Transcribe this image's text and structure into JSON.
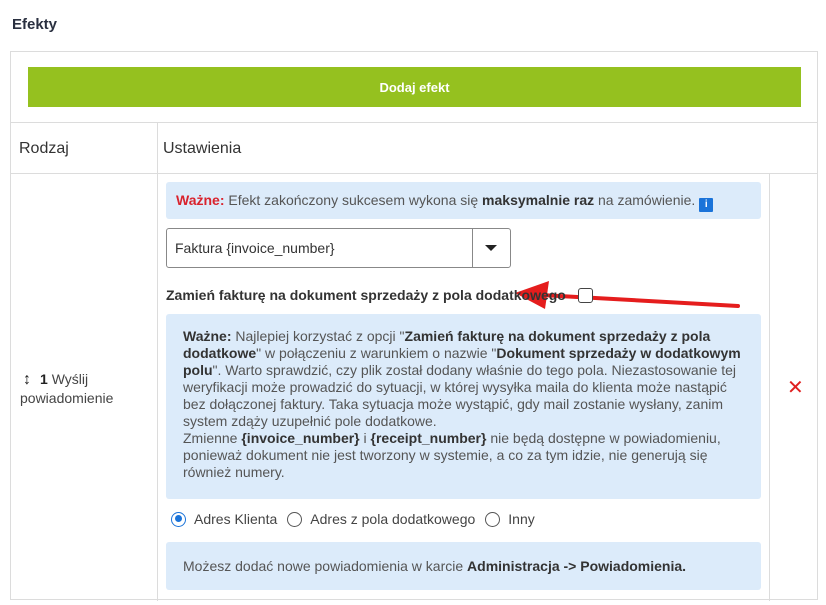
{
  "section": {
    "title": "Efekty"
  },
  "toolbar": {
    "add_label": "Dodaj efekt"
  },
  "table": {
    "headers": [
      "Rodzaj",
      "Ustawienia"
    ],
    "row": {
      "number": "1",
      "type_label": "Wyślij powiadomienie"
    }
  },
  "notice1": {
    "prefix": "Ważne:",
    "text_a": " Efekt zakończony sukcesem wykona się ",
    "bold": "maksymalnie raz",
    "text_b": " na zamówienie."
  },
  "info_icon_text": "i",
  "select": {
    "value": "Faktura {invoice_number}"
  },
  "checkbox": {
    "label": "Zamień fakturę na dokument sprzedaży z pola dodatkowego",
    "checked": false
  },
  "notice2": {
    "prefix": "Ważne:",
    "t1": " Najlepiej korzystać z opcji \"",
    "b1": "Zamień fakturę na dokument sprzedaży z pola dodatkowe",
    "t2": "\" w połączeniu z warunkiem o nazwie \"",
    "b2": "Dokument sprzedaży w dodatkowym polu",
    "t3": "\". Warto sprawdzić, czy plik został dodany właśnie do tego pola. Niezastosowanie tej weryfikacji może prowadzić do sytuacji, w której wysyłka maila do klienta może nastąpić bez dołączonej faktury. Taka sytuacja może wystąpić, gdy mail zostanie wysłany, zanim system zdąży uzupełnić pole dodatkowe.",
    "t4": "Zmienne ",
    "b3": "{invoice_number}",
    "t5": " i ",
    "b4": "{receipt_number}",
    "t6": " nie będą dostępne w powiadomieniu, ponieważ dokument nie jest tworzony w systemie, a co za tym idzie, nie generują się również numery."
  },
  "radio": {
    "options": [
      "Adres Klienta",
      "Adres z pola dodatkowego",
      "Inny"
    ],
    "selected": "Adres Klienta"
  },
  "notice3": {
    "text": "Możesz dodać nowe powiadomienia w karcie ",
    "bold": "Administracja -> Powiadomienia."
  },
  "colors": {
    "accent_green": "#95c11f",
    "info_bg": "#dcebfa",
    "danger": "#e02020",
    "primary": "#1a73d9"
  },
  "icons": {
    "delete": "close-icon",
    "drag": "sort-arrows-icon",
    "info": "info-icon",
    "dropdown": "caret-down-icon"
  }
}
